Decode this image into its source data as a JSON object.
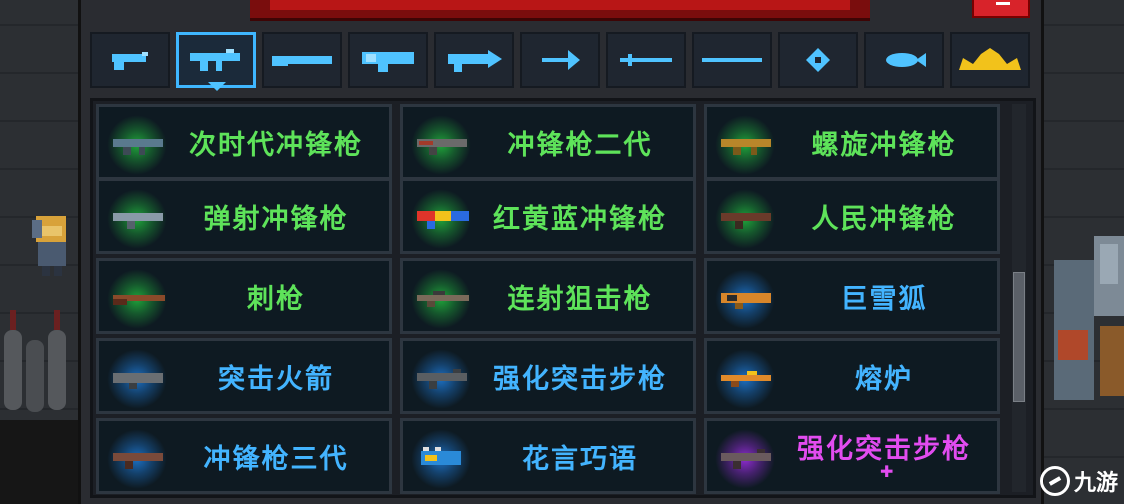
{
  "tabs": [
    {
      "icon": "pistol-icon",
      "selected": false
    },
    {
      "icon": "submachine-gun-icon",
      "selected": true
    },
    {
      "icon": "shotgun-icon",
      "selected": false
    },
    {
      "icon": "cannon-icon",
      "selected": false
    },
    {
      "icon": "laser-gun-icon",
      "selected": false
    },
    {
      "icon": "bow-icon",
      "selected": false
    },
    {
      "icon": "sword-icon",
      "selected": false
    },
    {
      "icon": "staff-icon",
      "selected": false
    },
    {
      "icon": "shuriken-icon",
      "selected": false
    },
    {
      "icon": "fish-icon",
      "selected": false
    },
    {
      "icon": "crown-icon",
      "selected": false
    }
  ],
  "weapons": [
    {
      "name": "次时代冲锋枪",
      "rarity": "green"
    },
    {
      "name": "冲锋枪二代",
      "rarity": "green"
    },
    {
      "name": "螺旋冲锋枪",
      "rarity": "green"
    },
    {
      "name": "弹射冲锋枪",
      "rarity": "green"
    },
    {
      "name": "红黄蓝冲锋枪",
      "rarity": "green"
    },
    {
      "name": "人民冲锋枪",
      "rarity": "green"
    },
    {
      "name": "刺枪",
      "rarity": "green"
    },
    {
      "name": "连射狙击枪",
      "rarity": "green"
    },
    {
      "name": "巨雪狐",
      "rarity": "blue"
    },
    {
      "name": "突击火箭",
      "rarity": "blue"
    },
    {
      "name": "强化突击步枪",
      "rarity": "blue"
    },
    {
      "name": "熔炉",
      "rarity": "blue"
    },
    {
      "name": "冲锋枪三代",
      "rarity": "blue"
    },
    {
      "name": "花言巧语",
      "rarity": "blue"
    },
    {
      "name": "强化突击步枪",
      "rarity": "purple"
    }
  ],
  "colors": {
    "green": "#5ee35a",
    "blue": "#43b4ff",
    "purple": "#e24cf0",
    "accent": "#3fb7ff"
  },
  "watermark": {
    "text": "九游"
  }
}
